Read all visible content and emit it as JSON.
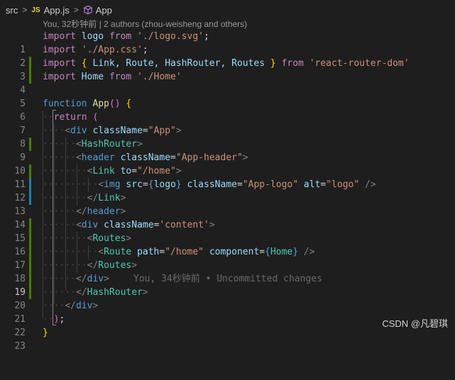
{
  "breadcrumb": {
    "folder": "src",
    "file": "App.js",
    "symbol": "App",
    "file_badge": "JS"
  },
  "blame": "You, 32秒钟前 | 2 authors (zhou-weisheng and others)",
  "editor": {
    "line_numbers": [
      "1",
      "2",
      "3",
      "4",
      "5",
      "6",
      "7",
      "8",
      "9",
      "10",
      "11",
      "12",
      "13",
      "14",
      "15",
      "16",
      "17",
      "18",
      "19",
      "20",
      "21",
      "22",
      "23"
    ],
    "tokens": {
      "l1": [
        "import",
        " logo ",
        "from",
        " ",
        "'./logo.svg'",
        ";"
      ],
      "l2": [
        "import",
        " ",
        "'./App.css'",
        ";"
      ],
      "l3": [
        "import",
        " ",
        "{",
        " Link, Route, HashRouter, Routes ",
        "}",
        " ",
        "from",
        " ",
        "'react-router-dom'"
      ],
      "l4": [
        "import",
        " Home ",
        "from",
        " ",
        "'./Home'"
      ],
      "l6": [
        "function",
        " ",
        "App",
        "()",
        " ",
        "{"
      ],
      "l7": [
        "return",
        " ",
        "("
      ],
      "l8": [
        "<",
        "div",
        " ",
        "className",
        "=",
        "\"App\"",
        ">"
      ],
      "l9": [
        "<",
        "HashRouter",
        ">"
      ],
      "l10": [
        "<",
        "header",
        " ",
        "className",
        "=",
        "\"App-header\"",
        ">"
      ],
      "l11": [
        "<",
        "Link",
        " ",
        "to",
        "=",
        "\"/home\"",
        ">"
      ],
      "l12": [
        "<",
        "img",
        " ",
        "src",
        "=",
        "{",
        "logo",
        "}",
        " ",
        "className",
        "=",
        "\"App-logo\"",
        " ",
        "alt",
        "=",
        "\"logo\"",
        " />"
      ],
      "l13": [
        "</",
        "Link",
        ">"
      ],
      "l14": [
        "</",
        "header",
        ">"
      ],
      "l15": [
        "<",
        "div",
        " ",
        "className",
        "=",
        "'content'",
        ">"
      ],
      "l16": [
        "<",
        "Routes",
        ">"
      ],
      "l17": [
        "<",
        "Route",
        " ",
        "path",
        "=",
        "\"/home\"",
        " ",
        "component",
        "=",
        "{",
        "Home",
        "}",
        " />"
      ],
      "l18": [
        "</",
        "Routes",
        ">"
      ],
      "l19": [
        "</",
        "div",
        ">"
      ],
      "l20": [
        "</",
        "HashRouter",
        ">"
      ],
      "l21": [
        "</",
        "div",
        ">"
      ],
      "l22": [
        ")",
        ";"
      ],
      "l23": [
        "}"
      ]
    },
    "ghost_text": "You, 34秒钟前 • Uncommitted changes"
  },
  "watermark": "CSDN @凡碧琪",
  "colors": {
    "background": "#1e1e1e",
    "keyword": "#c586c0",
    "string": "#ce9178",
    "tag": "#4ec9b0",
    "attribute": "#9cdcfe",
    "function": "#dcdcaa",
    "gutter_added": "#487e02",
    "gutter_modified": "#1b81a8"
  }
}
